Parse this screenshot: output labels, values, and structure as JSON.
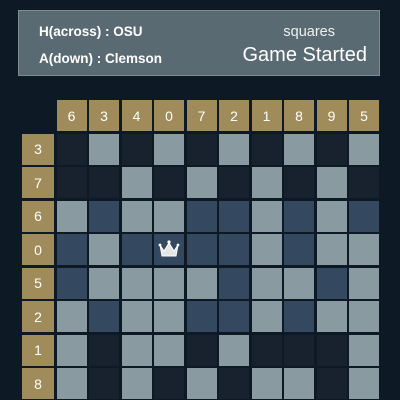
{
  "header": {
    "home_team": "H(across) : OSU",
    "away_team": "A(down) : Clemson",
    "game_label": "squares",
    "game_status": "Game Started"
  },
  "board": {
    "column_numbers": [
      "6",
      "3",
      "4",
      "0",
      "7",
      "2",
      "1",
      "8",
      "9",
      "5"
    ],
    "row_numbers": [
      "3",
      "7",
      "6",
      "0",
      "5",
      "2",
      "1",
      "8"
    ],
    "cells": [
      [
        "d",
        "l",
        "d",
        "l",
        "d",
        "l",
        "d",
        "l",
        "d",
        "l"
      ],
      [
        "d",
        "d",
        "l",
        "d",
        "l",
        "d",
        "l",
        "d",
        "l",
        "d"
      ],
      [
        "l",
        "b",
        "l",
        "l",
        "b",
        "b",
        "l",
        "b",
        "l",
        "b"
      ],
      [
        "b",
        "l",
        "b",
        "crown",
        "b",
        "b",
        "l",
        "b",
        "l",
        "l"
      ],
      [
        "b",
        "l",
        "l",
        "l",
        "l",
        "b",
        "l",
        "l",
        "b",
        "l"
      ],
      [
        "l",
        "b",
        "l",
        "l",
        "b",
        "b",
        "l",
        "b",
        "l",
        "l"
      ],
      [
        "l",
        "d",
        "l",
        "l",
        "d",
        "l",
        "d",
        "d",
        "d",
        "l"
      ],
      [
        "l",
        "d",
        "l",
        "d",
        "l",
        "d",
        "l",
        "l",
        "d",
        "l"
      ]
    ],
    "crown_icon": "crown-icon",
    "colors": {
      "header_tile": "#a08c5a",
      "dark_square": "#17222e",
      "light_square": "#8a9aa1",
      "blue_square": "#34495f",
      "background": "#0d1a26"
    }
  }
}
